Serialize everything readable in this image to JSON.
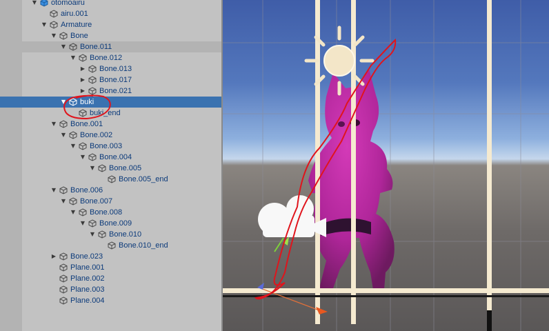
{
  "hierarchy": {
    "rows": [
      {
        "label": "otomoairu",
        "depth": 0,
        "arrow": "down",
        "icon": "prefab-cube-icon",
        "state": "normal"
      },
      {
        "label": "airu.001",
        "depth": 1,
        "arrow": "none",
        "icon": "cube-icon",
        "state": "normal"
      },
      {
        "label": "Armature",
        "depth": 1,
        "arrow": "down",
        "icon": "cube-icon",
        "state": "normal"
      },
      {
        "label": "Bone",
        "depth": 2,
        "arrow": "down",
        "icon": "cube-icon",
        "state": "normal"
      },
      {
        "label": "Bone.011",
        "depth": 3,
        "arrow": "down",
        "icon": "cube-icon",
        "state": "hover"
      },
      {
        "label": "Bone.012",
        "depth": 4,
        "arrow": "down",
        "icon": "cube-icon",
        "state": "normal"
      },
      {
        "label": "Bone.013",
        "depth": 5,
        "arrow": "right",
        "icon": "cube-icon",
        "state": "normal"
      },
      {
        "label": "Bone.017",
        "depth": 5,
        "arrow": "right",
        "icon": "cube-icon",
        "state": "normal"
      },
      {
        "label": "Bone.021",
        "depth": 5,
        "arrow": "right",
        "icon": "cube-icon",
        "state": "normal"
      },
      {
        "label": "buki",
        "depth": 3,
        "arrow": "down",
        "icon": "cube-icon",
        "state": "selected"
      },
      {
        "label": "buki_end",
        "depth": 4,
        "arrow": "none",
        "icon": "cube-icon",
        "state": "normal"
      },
      {
        "label": "Bone.001",
        "depth": 2,
        "arrow": "down",
        "icon": "cube-icon",
        "state": "normal"
      },
      {
        "label": "Bone.002",
        "depth": 3,
        "arrow": "down",
        "icon": "cube-icon",
        "state": "normal"
      },
      {
        "label": "Bone.003",
        "depth": 4,
        "arrow": "down",
        "icon": "cube-icon",
        "state": "normal"
      },
      {
        "label": "Bone.004",
        "depth": 5,
        "arrow": "down",
        "icon": "cube-icon",
        "state": "normal"
      },
      {
        "label": "Bone.005",
        "depth": 6,
        "arrow": "down",
        "icon": "cube-icon",
        "state": "normal"
      },
      {
        "label": "Bone.005_end",
        "depth": 7,
        "arrow": "none",
        "icon": "cube-icon",
        "state": "normal"
      },
      {
        "label": "Bone.006",
        "depth": 2,
        "arrow": "down",
        "icon": "cube-icon",
        "state": "normal"
      },
      {
        "label": "Bone.007",
        "depth": 3,
        "arrow": "down",
        "icon": "cube-icon",
        "state": "normal"
      },
      {
        "label": "Bone.008",
        "depth": 4,
        "arrow": "down",
        "icon": "cube-icon",
        "state": "normal"
      },
      {
        "label": "Bone.009",
        "depth": 5,
        "arrow": "down",
        "icon": "cube-icon",
        "state": "normal"
      },
      {
        "label": "Bone.010",
        "depth": 6,
        "arrow": "down",
        "icon": "cube-icon",
        "state": "normal"
      },
      {
        "label": "Bone.010_end",
        "depth": 7,
        "arrow": "none",
        "icon": "cube-icon",
        "state": "normal"
      },
      {
        "label": "Bone.023",
        "depth": 2,
        "arrow": "right",
        "icon": "cube-icon",
        "state": "normal"
      },
      {
        "label": "Plane.001",
        "depth": 2,
        "arrow": "none",
        "icon": "cube-icon",
        "state": "normal"
      },
      {
        "label": "Plane.002",
        "depth": 2,
        "arrow": "none",
        "icon": "cube-icon",
        "state": "normal"
      },
      {
        "label": "Plane.003",
        "depth": 2,
        "arrow": "none",
        "icon": "cube-icon",
        "state": "normal"
      },
      {
        "label": "Plane.004",
        "depth": 2,
        "arrow": "none",
        "icon": "cube-icon",
        "state": "normal"
      }
    ],
    "visibility_icons": [
      "eye-icon",
      "pickable-hand-icon"
    ]
  },
  "scene": {
    "gizmos": [
      "directional-light-icon",
      "camera-icon"
    ],
    "annotation": "red-freehand-circle"
  },
  "colors": {
    "selection": "#3a72b0",
    "label_text": "#0b3a7a",
    "panel_bg": "#c2c2c2",
    "model": "#b0269a",
    "annotation": "#e0141c"
  }
}
